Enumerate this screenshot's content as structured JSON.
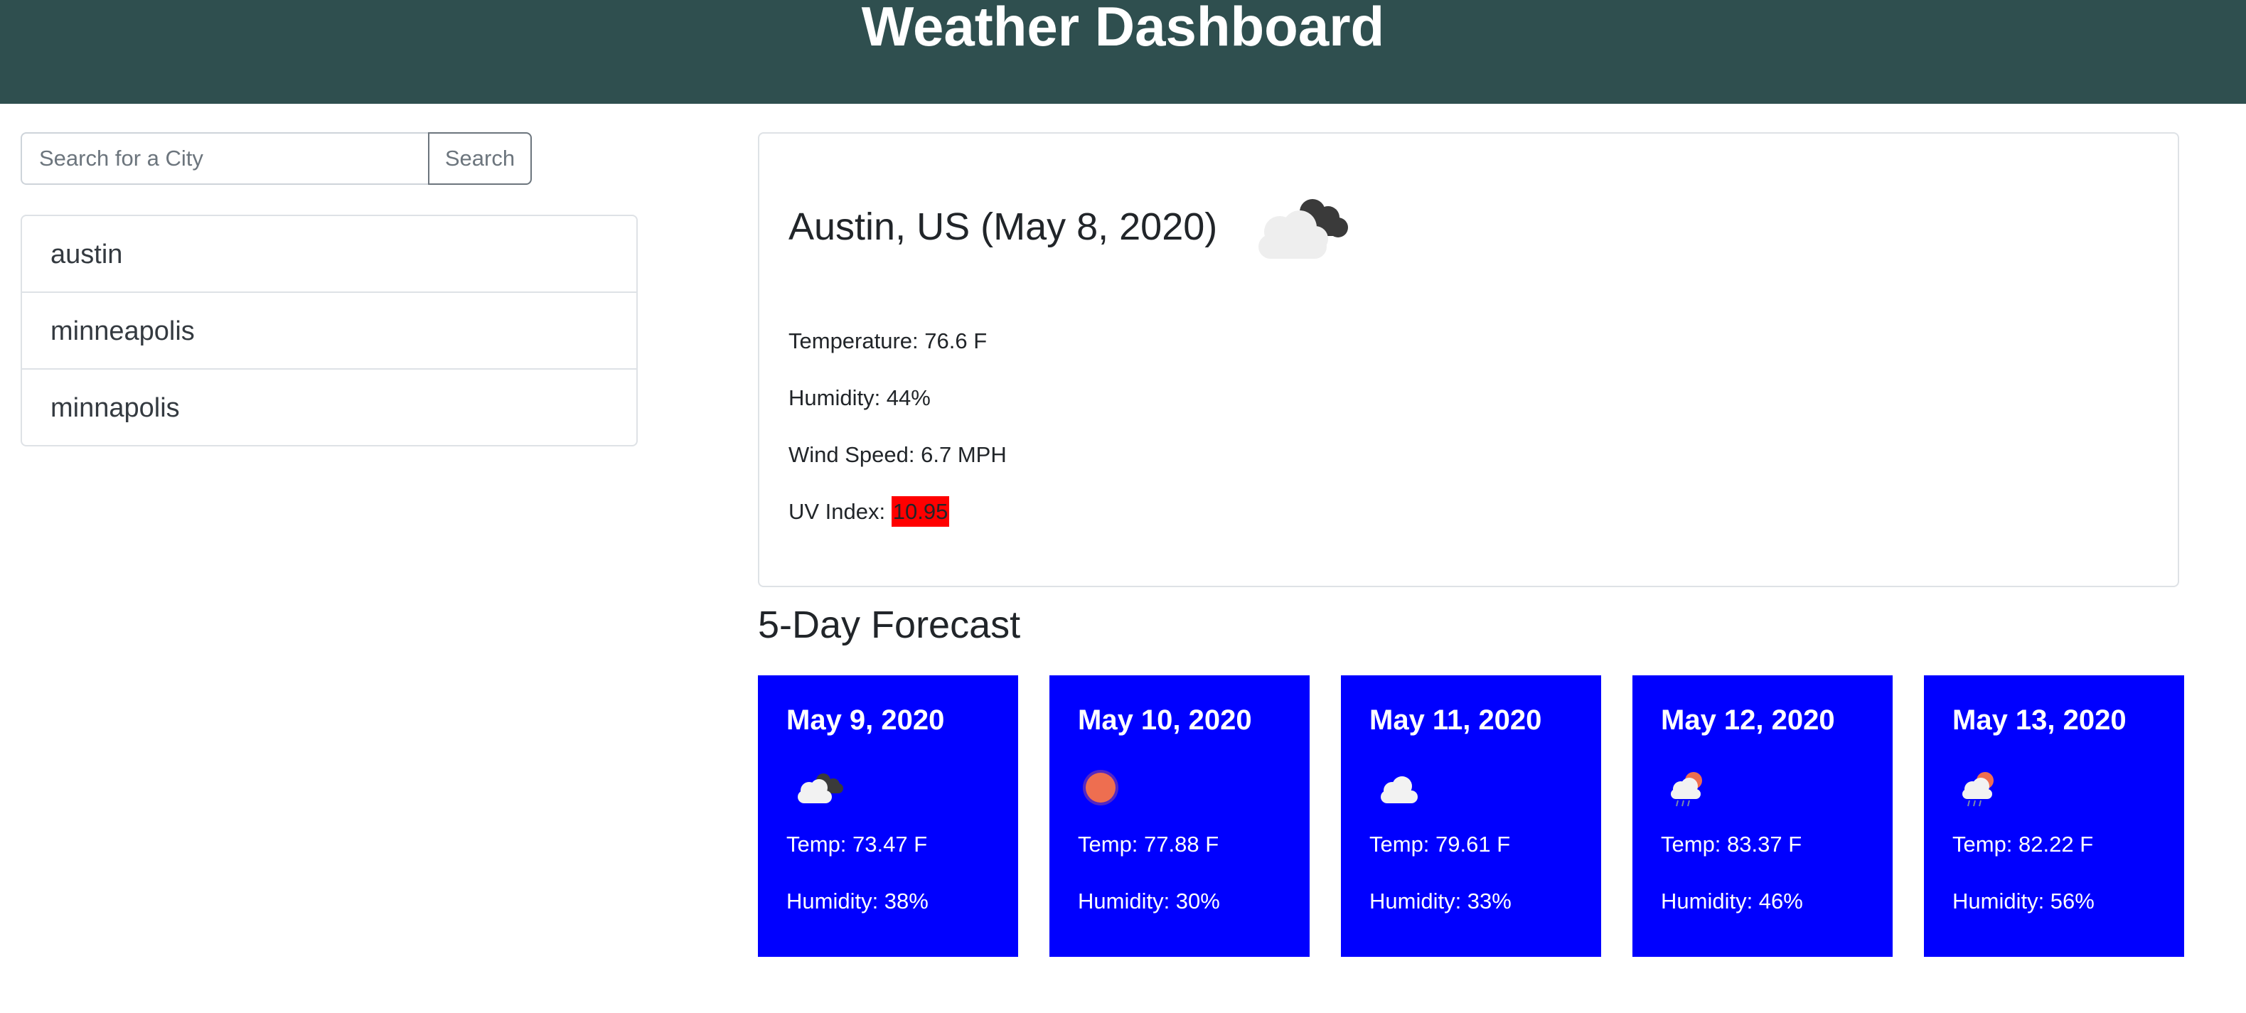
{
  "header": {
    "title": "Weather Dashboard"
  },
  "search": {
    "placeholder": "Search for a City",
    "button_label": "Search"
  },
  "history": {
    "items": [
      {
        "label": "austin"
      },
      {
        "label": "minneapolis"
      },
      {
        "label": "minnapolis"
      }
    ]
  },
  "current": {
    "title": "Austin, US (May 8, 2020)",
    "icon": "broken-clouds-icon",
    "temperature": "Temperature: 76.6 F",
    "humidity": "Humidity: 44%",
    "wind": "Wind Speed: 6.7 MPH",
    "uv_label": "UV Index: ",
    "uv_value": "10.95",
    "uv_color": "#ff0000"
  },
  "forecast": {
    "heading": "5-Day Forecast",
    "card_color": "#0000ff",
    "days": [
      {
        "date": "May 9, 2020",
        "icon": "broken-clouds-icon",
        "temp": "Temp: 73.47 F",
        "humidity": "Humidity: 38%"
      },
      {
        "date": "May 10, 2020",
        "icon": "clear-sky-sun-icon",
        "temp": "Temp: 77.88 F",
        "humidity": "Humidity: 30%"
      },
      {
        "date": "May 11, 2020",
        "icon": "few-clouds-icon",
        "temp": "Temp: 79.61 F",
        "humidity": "Humidity: 33%"
      },
      {
        "date": "May 12, 2020",
        "icon": "sun-rain-cloud-icon",
        "temp": "Temp: 83.37 F",
        "humidity": "Humidity: 46%"
      },
      {
        "date": "May 13, 2020",
        "icon": "sun-rain-cloud-icon",
        "temp": "Temp: 82.22 F",
        "humidity": "Humidity: 56%"
      }
    ]
  }
}
